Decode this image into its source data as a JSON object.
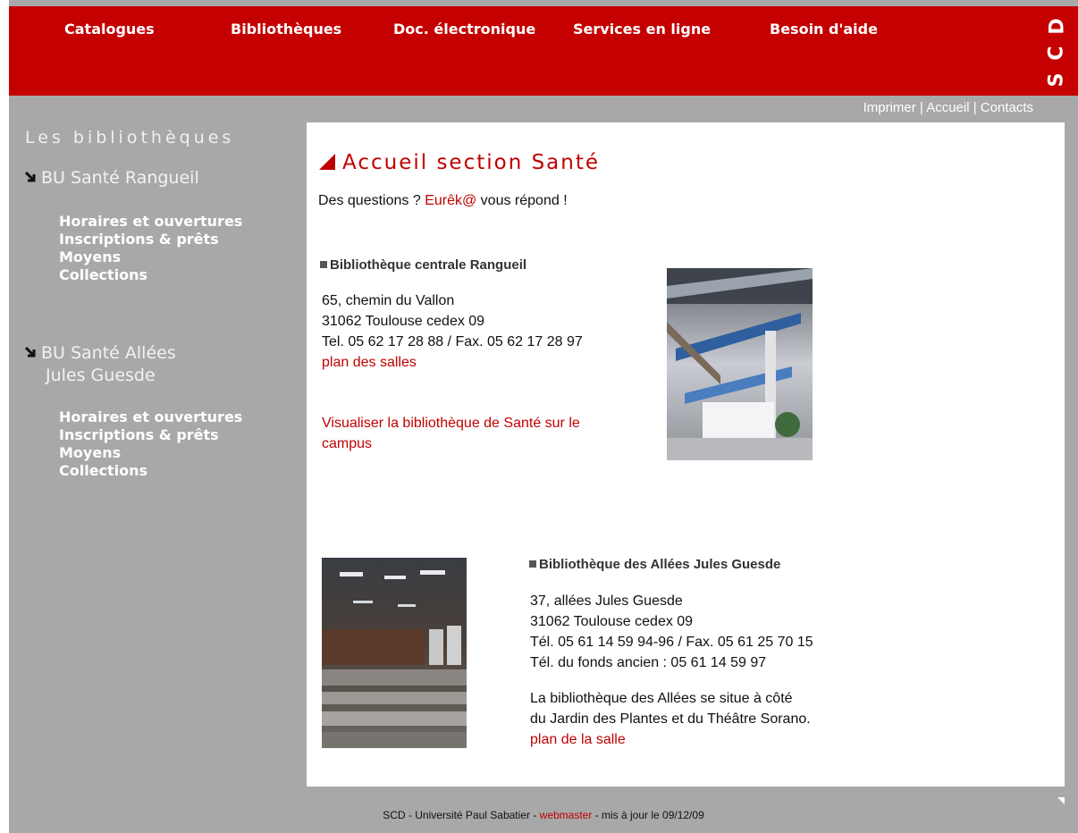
{
  "header": {
    "nav": [
      "Catalogues",
      "Bibliothèques",
      "Doc. électronique",
      "Services en ligne",
      "Besoin d'aide"
    ],
    "logo_letters": [
      "D",
      "C",
      "S"
    ],
    "toplinks": [
      "Imprimer",
      "|",
      "Accueil",
      "|",
      "Contacts"
    ]
  },
  "sidebar": {
    "title": "Les bibliothèques",
    "section1": {
      "label": "BU Santé Rangueil",
      "links": [
        "Horaires et ouvertures",
        "Inscriptions & prêts",
        "Moyens",
        "Collections"
      ]
    },
    "section2": {
      "label_line1": "BU Santé Allées",
      "label_line2": "Jules Guesde",
      "links": [
        "Horaires et ouvertures",
        "Inscriptions & prêts",
        "Moyens",
        "Collections"
      ]
    }
  },
  "main": {
    "title": "Accueil section Santé",
    "intro_before": "Des questions ? ",
    "intro_link": "Eurêk@",
    "intro_after": " vous répond !",
    "lib1": {
      "heading": "Bibliothèque centrale Rangueil",
      "address": [
        "65, chemin du Vallon",
        "31062 Toulouse cedex 09",
        "Tel. 05 62 17 28 88 / Fax. 05 62 17 28 97"
      ],
      "plan_link": "plan des salles",
      "campus_link_line1": "Visualiser la bibliothèque de Santé sur le",
      "campus_link_line2": "campus"
    },
    "lib2": {
      "heading": "Bibliothèque des Allées Jules Guesde",
      "address": [
        "37, allées Jules Guesde",
        "31062 Toulouse cedex 09",
        "Tél. 05 61 14 59 94-96 / Fax. 05 61 25 70 15",
        "Tél. du fonds ancien : 05 61 14 59 97"
      ],
      "desc": [
        "La bibliothèque des Allées se situe à côté",
        "du Jardin des Plantes et du Théâtre Sorano."
      ],
      "plan_link": "plan de la salle"
    }
  },
  "footer": {
    "before": "SCD - Université Paul Sabatier - ",
    "link": "webmaster",
    "after": " - mis à jour le 09/12/09"
  },
  "colors": {
    "brand_red": "#c50000",
    "sidebar_gray": "#a8a8a8",
    "link_red": "#c00000"
  }
}
